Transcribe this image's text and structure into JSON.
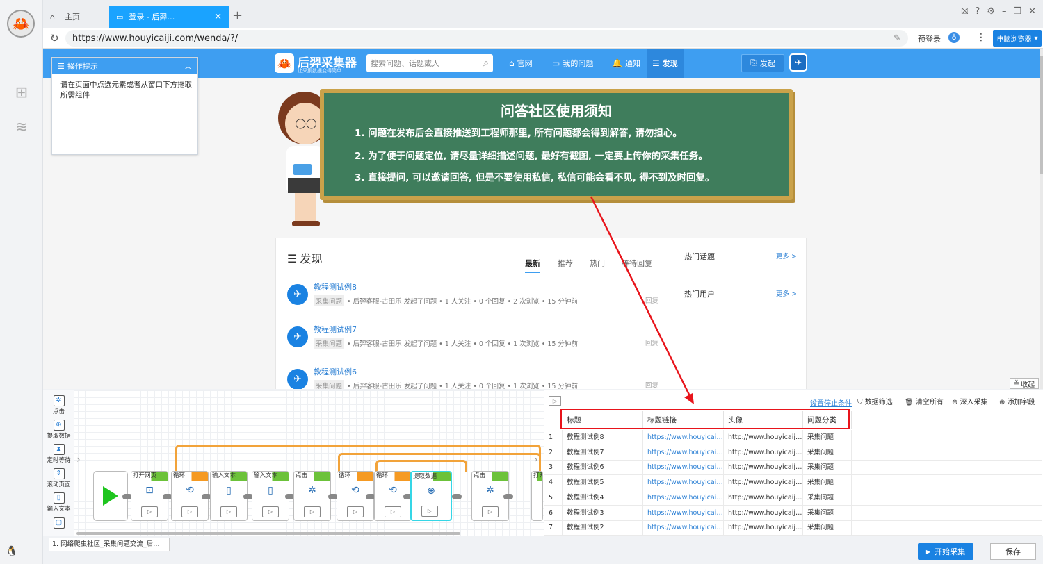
{
  "browser": {
    "tabs": [
      {
        "label": "主页"
      },
      {
        "label": "登录 - 后羿…"
      }
    ],
    "url": "https://www.houyicaiji.com/wenda/?/",
    "prelogin": "预登录",
    "browser_mode": "电脑浏览器"
  },
  "tips": {
    "title": "操作提示",
    "body": "请在页面中点选元素或者从窗口下方拖取所需组件"
  },
  "site": {
    "brand": "后羿采集器",
    "brand_sub": "让采集数据变得简单",
    "search_placeholder": "搜索问题、话题或人",
    "nav": [
      {
        "label": "官网",
        "icon": "home-icon"
      },
      {
        "label": "我的问题",
        "icon": "chat-icon"
      },
      {
        "label": "通知",
        "icon": "bell-icon"
      },
      {
        "label": "发现",
        "icon": "list-icon"
      }
    ],
    "launch": "发起"
  },
  "banner": {
    "title": "问答社区使用须知",
    "lines": [
      "1. 问题在发布后会直接推送到工程师那里, 所有问题都会得到解答, 请勿担心。",
      "2. 为了便于问题定位, 请尽量详细描述问题, 最好有截图, 一定要上传你的采集任务。",
      "3. 直接提问, 可以邀请回答, 但是不要使用私信, 私信可能会看不见, 得不到及时回复。"
    ]
  },
  "discover": {
    "title": "发现",
    "tabs": [
      "最新",
      "推荐",
      "热门",
      "等待回复"
    ],
    "items": [
      {
        "title": "教程测试例8",
        "tag": "采集问题",
        "meta": "• 后羿客服-古田乐 发起了问题 • 1 人关注 • 0 个回复 • 2 次浏览 • 15 分钟前",
        "reply": "回复"
      },
      {
        "title": "教程测试例7",
        "tag": "采集问题",
        "meta": "• 后羿客服-古田乐 发起了问题 • 1 人关注 • 0 个回复 • 1 次浏览 • 15 分钟前",
        "reply": "回复"
      },
      {
        "title": "教程测试例6",
        "tag": "采集问题",
        "meta": "• 后羿客服-古田乐 发起了问题 • 1 人关注 • 0 个回复 • 1 次浏览 • 15 分钟前",
        "reply": "回复"
      }
    ],
    "side": [
      {
        "label": "热门话题",
        "more": "更多 >"
      },
      {
        "label": "热门用户",
        "more": "更多 >"
      }
    ],
    "collapse": "收起"
  },
  "tools": [
    "点击",
    "提取数据",
    "定时等待",
    "滚动页面",
    "输入文本"
  ],
  "flow": {
    "nodes": [
      "打开网页",
      "循环",
      "输入文本",
      "输入文本",
      "点击",
      "循环",
      "循环",
      "提取数据",
      "点击",
      "打开"
    ]
  },
  "grid": {
    "stop_condition": "设置停止条件",
    "actions": [
      "数据筛选",
      "清空所有",
      "深入采集",
      "添加字段"
    ],
    "columns": [
      "标题",
      "标题链接",
      "头像",
      "问题分类"
    ],
    "rows": [
      [
        "1",
        "教程测试例8",
        "https://www.houyicaiji.c...",
        "http://www.houyicaiji.co...",
        "采集问题"
      ],
      [
        "2",
        "教程测试例7",
        "https://www.houyicaiji.c...",
        "http://www.houyicaiji.co...",
        "采集问题"
      ],
      [
        "3",
        "教程测试例6",
        "https://www.houyicaiji.c...",
        "http://www.houyicaiji.co...",
        "采集问题"
      ],
      [
        "4",
        "教程测试例5",
        "https://www.houyicaiji.c...",
        "http://www.houyicaiji.co...",
        "采集问题"
      ],
      [
        "5",
        "教程测试例4",
        "https://www.houyicaiji.c...",
        "http://www.houyicaiji.co...",
        "采集问题"
      ],
      [
        "6",
        "教程测试例3",
        "https://www.houyicaiji.c...",
        "http://www.houyicaiji.co...",
        "采集问题"
      ],
      [
        "7",
        "教程测试例2",
        "https://www.houyicaiji.c...",
        "http://www.houyicaiji.co...",
        "采集问题"
      ]
    ]
  },
  "bottom": {
    "task_tab": "1. 网络爬虫社区_采集问题交流_后…",
    "start": "开始采集",
    "save": "保存"
  },
  "colors": {
    "accent": "#3e9ef1",
    "highlight": "#e8141b",
    "board": "#3f7d5c"
  }
}
